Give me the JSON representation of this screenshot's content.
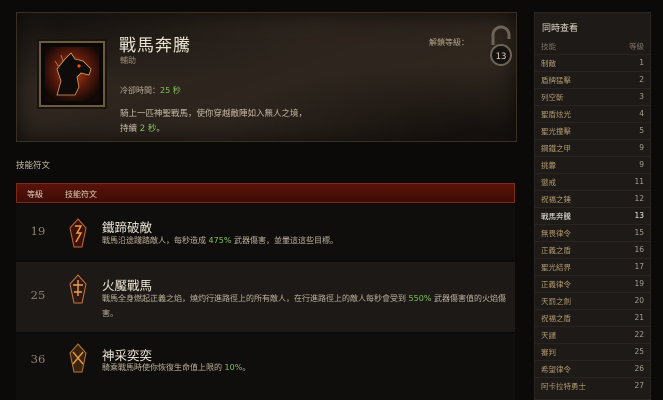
{
  "skill": {
    "name": "戰馬奔騰",
    "category": "輔助",
    "cooldown_label": "冷卻時間：",
    "cooldown_value": "25 秒",
    "description_part1": "騎上一匹神聖戰馬，使你穿越敵陣如入無人之境，",
    "description_part2": "持續 ",
    "description_duration": "2 秒",
    "description_part3": "。",
    "unlock_label": "解鎖等級：",
    "unlock_level": "13",
    "icon": "black-horse-head-icon"
  },
  "runes": {
    "heading": "技能符文",
    "columns": {
      "level": "等級",
      "rune": "技能符文"
    },
    "items": [
      {
        "level": "19",
        "name": "鐵蹄破敵",
        "icon": "rune-crimson-icon",
        "desc_a": "戰馬沿途踐踏敵人，每秒造成 ",
        "desc_hl": "475%",
        "desc_b": " 武器傷害，並暈這這些目標。"
      },
      {
        "level": "25",
        "name": "火魘戰馬",
        "icon": "rune-indigo-icon",
        "desc_a": "戰馬全身燃起正義之焰，燒灼行進路徑上的所有敵人，在行進路徑上的敵人每秒會受到 ",
        "desc_hl": "550%",
        "desc_b": " 武器傷害值的火焰傷害。"
      },
      {
        "level": "36",
        "name": "神采奕奕",
        "icon": "rune-golden-icon",
        "desc_a": "騎乘戰馬時使你恢復生命值上限的 ",
        "desc_hl": "10%",
        "desc_b": "。"
      }
    ]
  },
  "sidebar": {
    "title": "同時查看",
    "columns": {
      "skill": "技能",
      "level": "等級"
    },
    "items": [
      {
        "name": "制敵",
        "level": "1"
      },
      {
        "name": "盾牌猛擊",
        "level": "2"
      },
      {
        "name": "列空斬",
        "level": "3"
      },
      {
        "name": "聖盾炫光",
        "level": "4"
      },
      {
        "name": "聖光撞擊",
        "level": "5"
      },
      {
        "name": "鋼鐵之甲",
        "level": "9"
      },
      {
        "name": "挑釁",
        "level": "9"
      },
      {
        "name": "懲戒",
        "level": "11"
      },
      {
        "name": "祝福之錘",
        "level": "12"
      },
      {
        "name": "戰馬奔騰",
        "level": "13",
        "active": true
      },
      {
        "name": "無畏律令",
        "level": "15"
      },
      {
        "name": "正義之盾",
        "level": "16"
      },
      {
        "name": "聖光結界",
        "level": "17"
      },
      {
        "name": "正義律令",
        "level": "19"
      },
      {
        "name": "天罰之劍",
        "level": "20"
      },
      {
        "name": "祝福之盾",
        "level": "21"
      },
      {
        "name": "天譴",
        "level": "22"
      },
      {
        "name": "審判",
        "level": "25"
      },
      {
        "name": "希望律令",
        "level": "26"
      },
      {
        "name": "阿卡拉特勇士",
        "level": "27"
      }
    ]
  },
  "colors": {
    "highlight": "#7ec45a",
    "rune_header": "#5a130a"
  }
}
